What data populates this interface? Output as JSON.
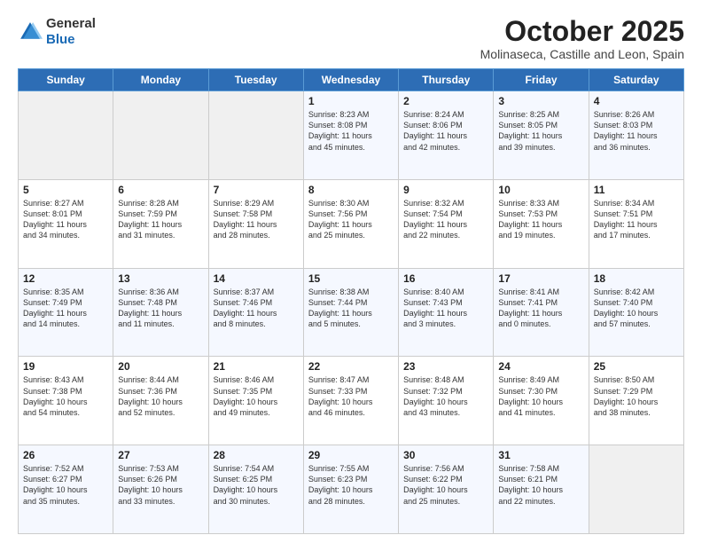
{
  "header": {
    "logo_general": "General",
    "logo_blue": "Blue",
    "month": "October 2025",
    "location": "Molinaseca, Castille and Leon, Spain"
  },
  "days_of_week": [
    "Sunday",
    "Monday",
    "Tuesday",
    "Wednesday",
    "Thursday",
    "Friday",
    "Saturday"
  ],
  "weeks": [
    [
      {
        "day": "",
        "data": ""
      },
      {
        "day": "",
        "data": ""
      },
      {
        "day": "",
        "data": ""
      },
      {
        "day": "1",
        "data": "Sunrise: 8:23 AM\nSunset: 8:08 PM\nDaylight: 11 hours\nand 45 minutes."
      },
      {
        "day": "2",
        "data": "Sunrise: 8:24 AM\nSunset: 8:06 PM\nDaylight: 11 hours\nand 42 minutes."
      },
      {
        "day": "3",
        "data": "Sunrise: 8:25 AM\nSunset: 8:05 PM\nDaylight: 11 hours\nand 39 minutes."
      },
      {
        "day": "4",
        "data": "Sunrise: 8:26 AM\nSunset: 8:03 PM\nDaylight: 11 hours\nand 36 minutes."
      }
    ],
    [
      {
        "day": "5",
        "data": "Sunrise: 8:27 AM\nSunset: 8:01 PM\nDaylight: 11 hours\nand 34 minutes."
      },
      {
        "day": "6",
        "data": "Sunrise: 8:28 AM\nSunset: 7:59 PM\nDaylight: 11 hours\nand 31 minutes."
      },
      {
        "day": "7",
        "data": "Sunrise: 8:29 AM\nSunset: 7:58 PM\nDaylight: 11 hours\nand 28 minutes."
      },
      {
        "day": "8",
        "data": "Sunrise: 8:30 AM\nSunset: 7:56 PM\nDaylight: 11 hours\nand 25 minutes."
      },
      {
        "day": "9",
        "data": "Sunrise: 8:32 AM\nSunset: 7:54 PM\nDaylight: 11 hours\nand 22 minutes."
      },
      {
        "day": "10",
        "data": "Sunrise: 8:33 AM\nSunset: 7:53 PM\nDaylight: 11 hours\nand 19 minutes."
      },
      {
        "day": "11",
        "data": "Sunrise: 8:34 AM\nSunset: 7:51 PM\nDaylight: 11 hours\nand 17 minutes."
      }
    ],
    [
      {
        "day": "12",
        "data": "Sunrise: 8:35 AM\nSunset: 7:49 PM\nDaylight: 11 hours\nand 14 minutes."
      },
      {
        "day": "13",
        "data": "Sunrise: 8:36 AM\nSunset: 7:48 PM\nDaylight: 11 hours\nand 11 minutes."
      },
      {
        "day": "14",
        "data": "Sunrise: 8:37 AM\nSunset: 7:46 PM\nDaylight: 11 hours\nand 8 minutes."
      },
      {
        "day": "15",
        "data": "Sunrise: 8:38 AM\nSunset: 7:44 PM\nDaylight: 11 hours\nand 5 minutes."
      },
      {
        "day": "16",
        "data": "Sunrise: 8:40 AM\nSunset: 7:43 PM\nDaylight: 11 hours\nand 3 minutes."
      },
      {
        "day": "17",
        "data": "Sunrise: 8:41 AM\nSunset: 7:41 PM\nDaylight: 11 hours\nand 0 minutes."
      },
      {
        "day": "18",
        "data": "Sunrise: 8:42 AM\nSunset: 7:40 PM\nDaylight: 10 hours\nand 57 minutes."
      }
    ],
    [
      {
        "day": "19",
        "data": "Sunrise: 8:43 AM\nSunset: 7:38 PM\nDaylight: 10 hours\nand 54 minutes."
      },
      {
        "day": "20",
        "data": "Sunrise: 8:44 AM\nSunset: 7:36 PM\nDaylight: 10 hours\nand 52 minutes."
      },
      {
        "day": "21",
        "data": "Sunrise: 8:46 AM\nSunset: 7:35 PM\nDaylight: 10 hours\nand 49 minutes."
      },
      {
        "day": "22",
        "data": "Sunrise: 8:47 AM\nSunset: 7:33 PM\nDaylight: 10 hours\nand 46 minutes."
      },
      {
        "day": "23",
        "data": "Sunrise: 8:48 AM\nSunset: 7:32 PM\nDaylight: 10 hours\nand 43 minutes."
      },
      {
        "day": "24",
        "data": "Sunrise: 8:49 AM\nSunset: 7:30 PM\nDaylight: 10 hours\nand 41 minutes."
      },
      {
        "day": "25",
        "data": "Sunrise: 8:50 AM\nSunset: 7:29 PM\nDaylight: 10 hours\nand 38 minutes."
      }
    ],
    [
      {
        "day": "26",
        "data": "Sunrise: 7:52 AM\nSunset: 6:27 PM\nDaylight: 10 hours\nand 35 minutes."
      },
      {
        "day": "27",
        "data": "Sunrise: 7:53 AM\nSunset: 6:26 PM\nDaylight: 10 hours\nand 33 minutes."
      },
      {
        "day": "28",
        "data": "Sunrise: 7:54 AM\nSunset: 6:25 PM\nDaylight: 10 hours\nand 30 minutes."
      },
      {
        "day": "29",
        "data": "Sunrise: 7:55 AM\nSunset: 6:23 PM\nDaylight: 10 hours\nand 28 minutes."
      },
      {
        "day": "30",
        "data": "Sunrise: 7:56 AM\nSunset: 6:22 PM\nDaylight: 10 hours\nand 25 minutes."
      },
      {
        "day": "31",
        "data": "Sunrise: 7:58 AM\nSunset: 6:21 PM\nDaylight: 10 hours\nand 22 minutes."
      },
      {
        "day": "",
        "data": ""
      }
    ]
  ]
}
